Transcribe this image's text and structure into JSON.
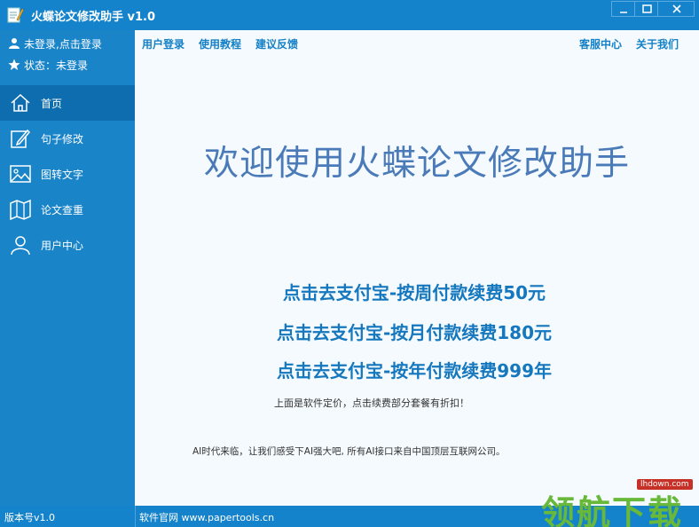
{
  "window": {
    "title": "火蝶论文修改助手 v1.0",
    "buttons": [
      "minimize",
      "maximize",
      "close"
    ]
  },
  "sidebar": {
    "user_login_text": "未登录,点击登录",
    "status_text": "状态：未登录",
    "items": [
      {
        "label": "首页",
        "icon": "home-icon",
        "active": true
      },
      {
        "label": "句子修改",
        "icon": "edit-icon",
        "active": false
      },
      {
        "label": "图转文字",
        "icon": "image-icon",
        "active": false
      },
      {
        "label": "论文查重",
        "icon": "map-icon",
        "active": false
      },
      {
        "label": "用户中心",
        "icon": "user-icon",
        "active": false
      }
    ]
  },
  "topnav": {
    "left": [
      "用户登录",
      "使用教程",
      "建议反馈"
    ],
    "right": [
      "客服中心",
      "关于我们"
    ]
  },
  "main": {
    "welcome": "欢迎使用火蝶论文修改助手",
    "prices": [
      "点击去支付宝-按周付款续费50元",
      "点击去支付宝-按月付款续费180元",
      "点击去支付宝-按年付款续费999年"
    ],
    "price_note": "上面是软件定价，点击续费部分套餐有折扣！",
    "ai_note": "AI时代来临，让我们感受下AI强大吧, 所有AI接口来自中国顶层互联网公司。"
  },
  "statusbar": {
    "version": "版本号v1.0",
    "website": "软件官网 www.papertools.cn"
  },
  "watermark": {
    "url": "lhdown.com",
    "text": "领航下载"
  },
  "colors": {
    "accent": "#1583cb",
    "sidebar": "#1a84c9",
    "sidebar_active": "#0d6dae",
    "content_bg": "#f4fafe",
    "link": "#1480c6",
    "welcome": "#4a7ab8"
  }
}
